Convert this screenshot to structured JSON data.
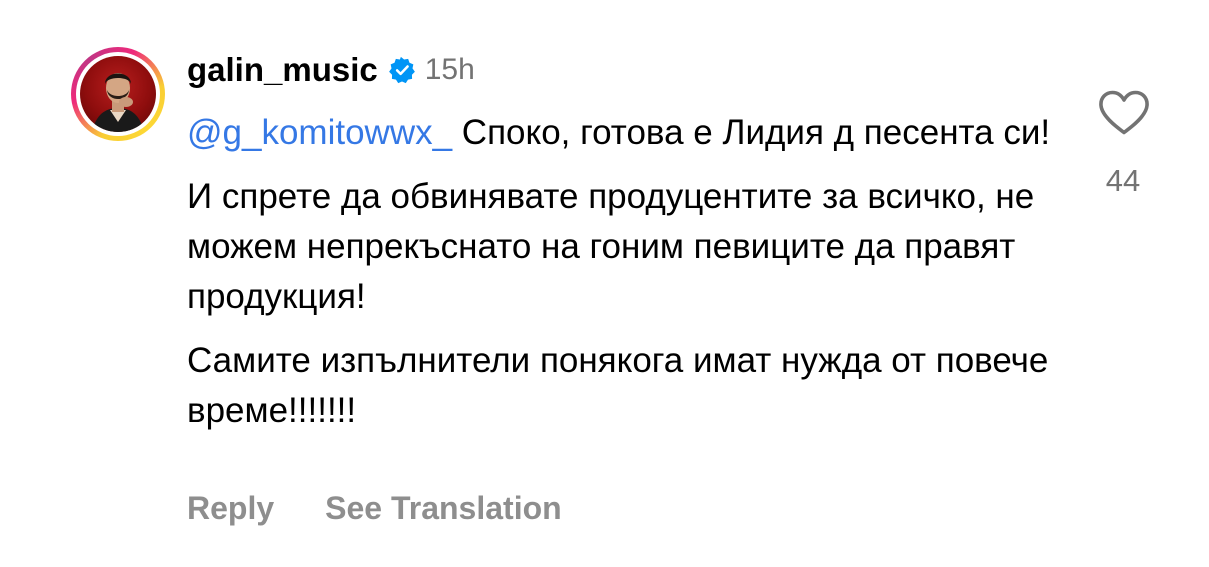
{
  "comment": {
    "username": "galin_music",
    "verified_icon": "verified-badge-icon",
    "timestamp": "15h",
    "mention": "@g_komitowwx_",
    "paragraph1_rest": " Споко, готова е Лидия д песента си!",
    "paragraph2": "И спрете да обвинявате продуцентите за всичко, не можем непрекъснато на гоним певиците да правят продукция!",
    "paragraph3": "Самите изпълнители понякога имат нужда от повече време!!!!!!!",
    "like_icon": "heart-icon",
    "like_count": "44",
    "reply_label": "Reply",
    "translate_label": "See Translation"
  },
  "colors": {
    "mention": "#3578e5",
    "muted": "#737373",
    "verified": "#0095f6",
    "story_ring_start": "#f9ce34",
    "story_ring_end": "#ee2a7b"
  }
}
